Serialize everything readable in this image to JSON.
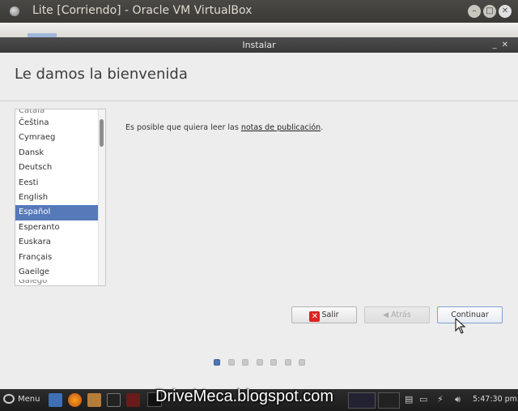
{
  "host_window": {
    "title": "Lite [Corriendo] - Oracle VM VirtualBox",
    "min_icon": "minimize-icon",
    "max_icon": "maximize-icon",
    "close_icon": "close-icon"
  },
  "installer": {
    "window_title": "Instalar",
    "heading": "Le damos la bienvenida",
    "languages": [
      {
        "label": "Català",
        "partial": true
      },
      {
        "label": "Čeština"
      },
      {
        "label": "Cymraeg"
      },
      {
        "label": "Dansk"
      },
      {
        "label": "Deutsch"
      },
      {
        "label": "Eesti"
      },
      {
        "label": "English"
      },
      {
        "label": "Español",
        "selected": true
      },
      {
        "label": "Esperanto"
      },
      {
        "label": "Euskara"
      },
      {
        "label": "Français"
      },
      {
        "label": "Gaeilge"
      },
      {
        "label": "Galego",
        "partial": true
      }
    ],
    "release_note_prefix": "Es posible que quiera leer las ",
    "release_note_link": "notas de publicación",
    "release_note_suffix": ".",
    "buttons": {
      "quit": "Salir",
      "back": "Atrás",
      "continue": "Continuar"
    },
    "progress": {
      "total_steps": 7,
      "current_step": 1
    }
  },
  "taskbar": {
    "menu_label": "Menu",
    "clock": "5:47:30 pm"
  },
  "watermark": "DriveMeca.blogspot.com",
  "colors": {
    "selection": "#5579b9",
    "active_dot": "#4a75b5"
  }
}
